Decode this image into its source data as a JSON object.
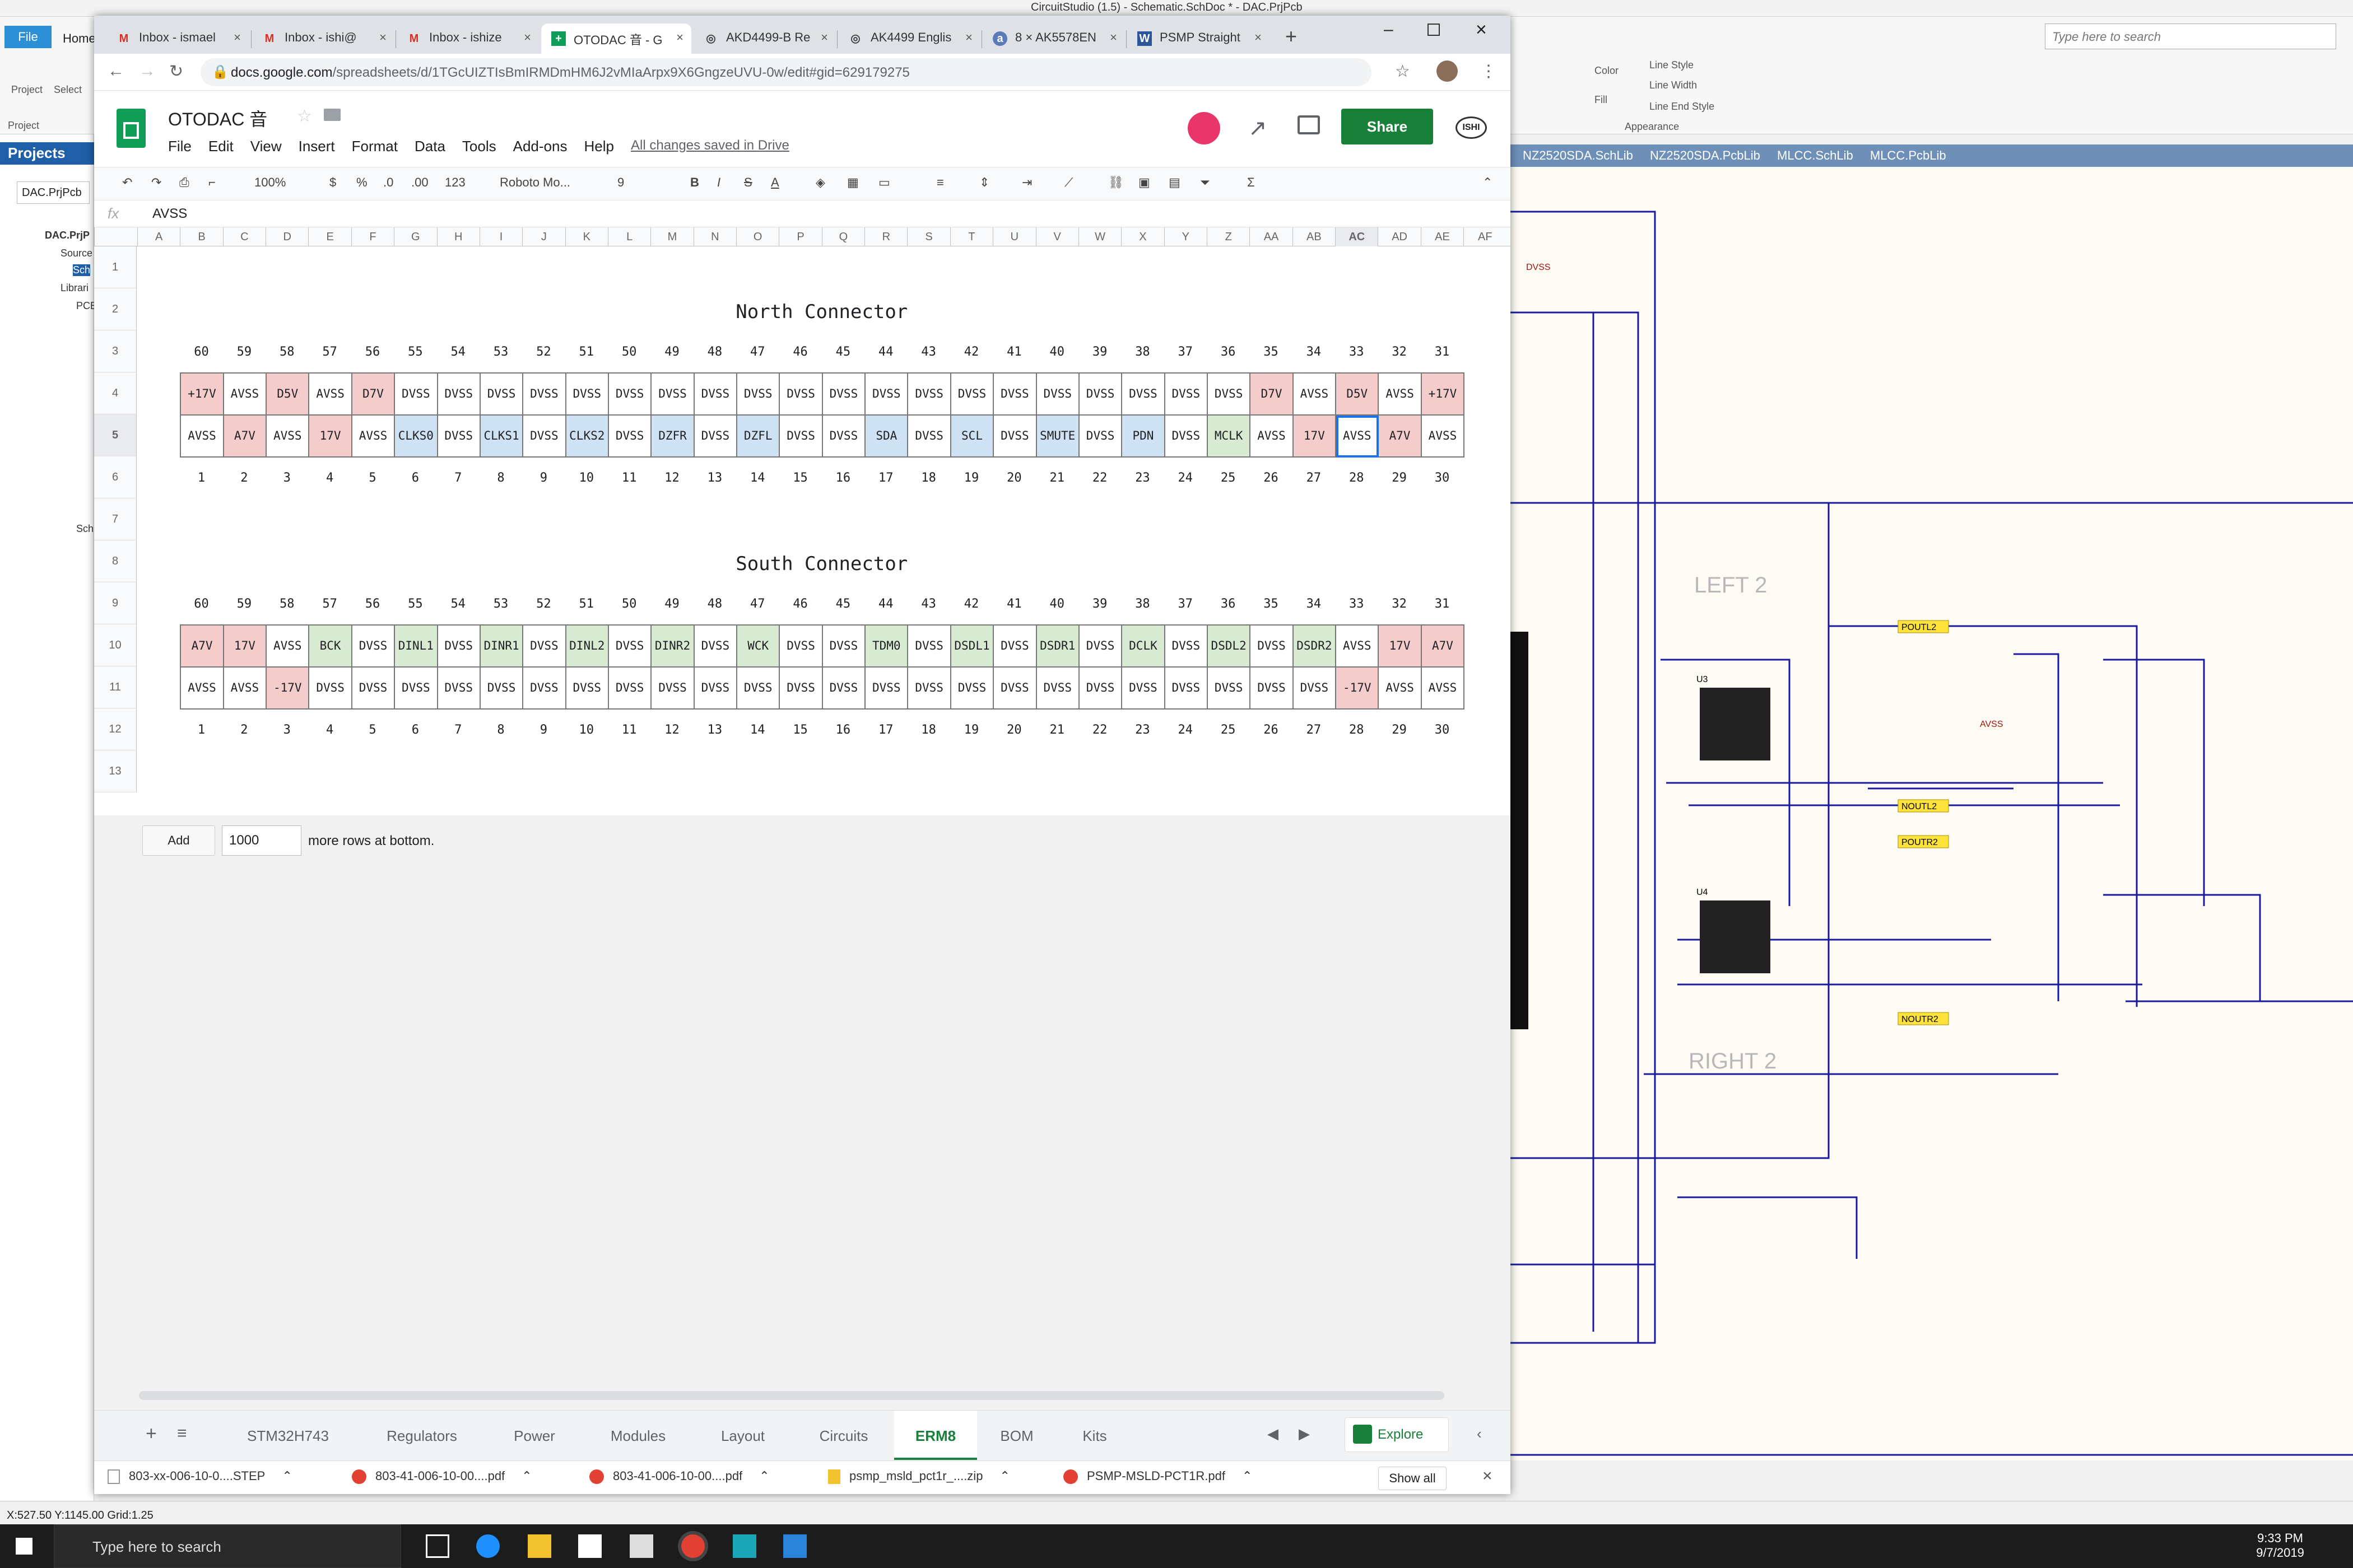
{
  "circuitstudio": {
    "title": "CircuitStudio (1.5) - Schematic.SchDoc * - DAC.PrjPcb",
    "file_tab": "File",
    "home_tab": "Home",
    "search_placeholder": "Type here to search",
    "ribbon": {
      "project": "Project",
      "select": "Select",
      "project_group": "Project",
      "color": "Color",
      "fill": "Fill",
      "line_style": "Line Style",
      "line_width": "Line Width",
      "line_end_style": "Line End Style",
      "appearance": "Appearance"
    },
    "projects_header": "Projects",
    "project_field": "DAC.PrjPcb",
    "tree": [
      "DAC.PrjP",
      "Source",
      "Sch",
      "Librari",
      "PCB",
      "Sch"
    ],
    "doc_tabs": [
      "NZ2520SDA.SchLib",
      "NZ2520SDA.PcbLib",
      "MLCC.SchLib",
      "MLCC.PcbLib"
    ],
    "schematic_labels": [
      "LEFT 2",
      "RIGHT 2",
      "POUTL2",
      "NOUTL2",
      "POUTR2",
      "NOUTR2",
      "AVSS",
      "DVSS",
      "U3",
      "U4"
    ],
    "status": "X:527.50 Y:1145.00   Grid:1.25"
  },
  "browser": {
    "tabs": [
      {
        "icon": "gmail-icon",
        "glyph": "M",
        "label": "Inbox - ismael"
      },
      {
        "icon": "gmail-icon",
        "glyph": "M",
        "label": "Inbox - ishi@"
      },
      {
        "icon": "gmail-icon",
        "glyph": "M",
        "label": "Inbox - ishize"
      },
      {
        "icon": "sheets-icon",
        "glyph": "+",
        "label": "OTODAC 音 - G"
      },
      {
        "icon": "globe-icon",
        "glyph": "◎",
        "label": "AKD4499-B Re"
      },
      {
        "icon": "globe-icon",
        "glyph": "◎",
        "label": "AK4499 Englis"
      },
      {
        "icon": "amazon-icon",
        "glyph": "a",
        "label": "8 × AK5578EN"
      },
      {
        "icon": "word-icon",
        "glyph": "W",
        "label": "PSMP Straight"
      }
    ],
    "url_host": "docs.google.com",
    "url_path": "/spreadsheets/d/1TGcUIZTIsBmIRMDmHM6J2vMIaArpx9X6GngzeUVU-0w/edit#gid=629179275"
  },
  "sheets": {
    "doc_title": "OTODAC 音",
    "menus": [
      "File",
      "Edit",
      "View",
      "Insert",
      "Format",
      "Data",
      "Tools",
      "Add-ons",
      "Help"
    ],
    "saved_status": "All changes saved in Drive",
    "share": "Share",
    "account": "ISHI",
    "toolbar": {
      "zoom": "100%",
      "currency": "$",
      "percent": "%",
      "dec_less": ".0",
      "dec_more": ".00",
      "format": "123",
      "font": "Roboto Mo...",
      "size": "9",
      "bold": "B",
      "italic": "I",
      "strike": "S",
      "text_color": "A",
      "sum": "Σ"
    },
    "formula_value": "AVSS",
    "columns": [
      "A",
      "B",
      "C",
      "D",
      "E",
      "F",
      "G",
      "H",
      "I",
      "J",
      "K",
      "L",
      "M",
      "N",
      "O",
      "P",
      "Q",
      "R",
      "S",
      "T",
      "U",
      "V",
      "W",
      "X",
      "Y",
      "Z",
      "AA",
      "AB",
      "AC",
      "AD",
      "AE",
      "AF"
    ],
    "rows": [
      "1",
      "2",
      "3",
      "4",
      "5",
      "6",
      "7",
      "8",
      "9",
      "10",
      "11",
      "12",
      "13"
    ],
    "north": {
      "title": "North Connector",
      "top_pins": [
        "60",
        "59",
        "58",
        "57",
        "56",
        "55",
        "54",
        "53",
        "52",
        "51",
        "50",
        "49",
        "48",
        "47",
        "46",
        "45",
        "44",
        "43",
        "42",
        "41",
        "40",
        "39",
        "38",
        "37",
        "36",
        "35",
        "34",
        "33",
        "32",
        "31"
      ],
      "row_a": [
        [
          "+17V",
          "r"
        ],
        [
          "AVSS",
          ""
        ],
        [
          "D5V",
          "r"
        ],
        [
          "AVSS",
          ""
        ],
        [
          "D7V",
          "r"
        ],
        [
          "DVSS",
          ""
        ],
        [
          "DVSS",
          ""
        ],
        [
          "DVSS",
          ""
        ],
        [
          "DVSS",
          ""
        ],
        [
          "DVSS",
          ""
        ],
        [
          "DVSS",
          ""
        ],
        [
          "DVSS",
          ""
        ],
        [
          "DVSS",
          ""
        ],
        [
          "DVSS",
          ""
        ],
        [
          "DVSS",
          ""
        ],
        [
          "DVSS",
          ""
        ],
        [
          "DVSS",
          ""
        ],
        [
          "DVSS",
          ""
        ],
        [
          "DVSS",
          ""
        ],
        [
          "DVSS",
          ""
        ],
        [
          "DVSS",
          ""
        ],
        [
          "DVSS",
          ""
        ],
        [
          "DVSS",
          ""
        ],
        [
          "DVSS",
          ""
        ],
        [
          "DVSS",
          ""
        ],
        [
          "D7V",
          "r"
        ],
        [
          "AVSS",
          ""
        ],
        [
          "D5V",
          "r"
        ],
        [
          "AVSS",
          ""
        ],
        [
          "+17V",
          "r"
        ]
      ],
      "row_b": [
        [
          "AVSS",
          ""
        ],
        [
          "A7V",
          "r"
        ],
        [
          "AVSS",
          ""
        ],
        [
          "17V",
          "r"
        ],
        [
          "AVSS",
          ""
        ],
        [
          "CLKS0",
          "b"
        ],
        [
          "DVSS",
          ""
        ],
        [
          "CLKS1",
          "b"
        ],
        [
          "DVSS",
          ""
        ],
        [
          "CLKS2",
          "b"
        ],
        [
          "DVSS",
          ""
        ],
        [
          "DZFR",
          "b"
        ],
        [
          "DVSS",
          ""
        ],
        [
          "DZFL",
          "b"
        ],
        [
          "DVSS",
          ""
        ],
        [
          "DVSS",
          ""
        ],
        [
          "SDA",
          "b"
        ],
        [
          "DVSS",
          ""
        ],
        [
          "SCL",
          "b"
        ],
        [
          "DVSS",
          ""
        ],
        [
          "SMUTE",
          "b"
        ],
        [
          "DVSS",
          ""
        ],
        [
          "PDN",
          "b"
        ],
        [
          "DVSS",
          ""
        ],
        [
          "MCLK",
          "g"
        ],
        [
          "AVSS",
          ""
        ],
        [
          "17V",
          "r"
        ],
        [
          "AVSS",
          ""
        ],
        [
          "A7V",
          "r"
        ],
        [
          "AVSS",
          ""
        ]
      ],
      "bottom_pins": [
        "1",
        "2",
        "3",
        "4",
        "5",
        "6",
        "7",
        "8",
        "9",
        "10",
        "11",
        "12",
        "13",
        "14",
        "15",
        "16",
        "17",
        "18",
        "19",
        "20",
        "21",
        "22",
        "23",
        "24",
        "25",
        "26",
        "27",
        "28",
        "29",
        "30"
      ]
    },
    "south": {
      "title": "South Connector",
      "top_pins": [
        "60",
        "59",
        "58",
        "57",
        "56",
        "55",
        "54",
        "53",
        "52",
        "51",
        "50",
        "49",
        "48",
        "47",
        "46",
        "45",
        "44",
        "43",
        "42",
        "41",
        "40",
        "39",
        "38",
        "37",
        "36",
        "35",
        "34",
        "33",
        "32",
        "31"
      ],
      "row_a": [
        [
          "A7V",
          "r"
        ],
        [
          "17V",
          "r"
        ],
        [
          "AVSS",
          ""
        ],
        [
          "BCK",
          "g"
        ],
        [
          "DVSS",
          ""
        ],
        [
          "DINL1",
          "g"
        ],
        [
          "DVSS",
          ""
        ],
        [
          "DINR1",
          "g"
        ],
        [
          "DVSS",
          ""
        ],
        [
          "DINL2",
          "g"
        ],
        [
          "DVSS",
          ""
        ],
        [
          "DINR2",
          "g"
        ],
        [
          "DVSS",
          ""
        ],
        [
          "WCK",
          "g"
        ],
        [
          "DVSS",
          ""
        ],
        [
          "DVSS",
          ""
        ],
        [
          "TDM0",
          "g"
        ],
        [
          "DVSS",
          ""
        ],
        [
          "DSDL1",
          "g"
        ],
        [
          "DVSS",
          ""
        ],
        [
          "DSDR1",
          "g"
        ],
        [
          "DVSS",
          ""
        ],
        [
          "DCLK",
          "g"
        ],
        [
          "DVSS",
          ""
        ],
        [
          "DSDL2",
          "g"
        ],
        [
          "DVSS",
          ""
        ],
        [
          "DSDR2",
          "g"
        ],
        [
          "AVSS",
          ""
        ],
        [
          "17V",
          "r"
        ],
        [
          "A7V",
          "r"
        ]
      ],
      "row_b": [
        [
          "AVSS",
          ""
        ],
        [
          "AVSS",
          ""
        ],
        [
          "-17V",
          "r"
        ],
        [
          "DVSS",
          ""
        ],
        [
          "DVSS",
          ""
        ],
        [
          "DVSS",
          ""
        ],
        [
          "DVSS",
          ""
        ],
        [
          "DVSS",
          ""
        ],
        [
          "DVSS",
          ""
        ],
        [
          "DVSS",
          ""
        ],
        [
          "DVSS",
          ""
        ],
        [
          "DVSS",
          ""
        ],
        [
          "DVSS",
          ""
        ],
        [
          "DVSS",
          ""
        ],
        [
          "DVSS",
          ""
        ],
        [
          "DVSS",
          ""
        ],
        [
          "DVSS",
          ""
        ],
        [
          "DVSS",
          ""
        ],
        [
          "DVSS",
          ""
        ],
        [
          "DVSS",
          ""
        ],
        [
          "DVSS",
          ""
        ],
        [
          "DVSS",
          ""
        ],
        [
          "DVSS",
          ""
        ],
        [
          "DVSS",
          ""
        ],
        [
          "DVSS",
          ""
        ],
        [
          "DVSS",
          ""
        ],
        [
          "DVSS",
          ""
        ],
        [
          "-17V",
          "r"
        ],
        [
          "AVSS",
          ""
        ],
        [
          "AVSS",
          ""
        ]
      ],
      "bottom_pins": [
        "1",
        "2",
        "3",
        "4",
        "5",
        "6",
        "7",
        "8",
        "9",
        "10",
        "11",
        "12",
        "13",
        "14",
        "15",
        "16",
        "17",
        "18",
        "19",
        "20",
        "21",
        "22",
        "23",
        "24",
        "25",
        "26",
        "27",
        "28",
        "29",
        "30"
      ]
    },
    "add_button": "Add",
    "add_count": "1000",
    "add_text": "more rows at bottom.",
    "sheet_tabs": [
      "STM32H743",
      "Regulators",
      "Power",
      "Modules",
      "Layout",
      "Circuits",
      "ERM8",
      "BOM",
      "Kits"
    ],
    "active_sheet": "ERM8",
    "explore": "Explore"
  },
  "downloads": {
    "items": [
      "803-xx-006-10-0....STEP",
      "803-41-006-10-00....pdf",
      "803-41-006-10-00....pdf",
      "psmp_msld_pct1r_....zip",
      "PSMP-MSLD-PCT1R.pdf"
    ],
    "show_all": "Show all"
  },
  "taskbar": {
    "search": "Type here to search",
    "time": "9:33 PM",
    "date": "9/7/2019"
  },
  "colors": {
    "red_cell": "#f4cccc",
    "blue_cell": "#cfe2f3",
    "green_cell": "#d9ead3",
    "sheets_green": "#188038",
    "cs_blue": "#1f5fa8"
  }
}
